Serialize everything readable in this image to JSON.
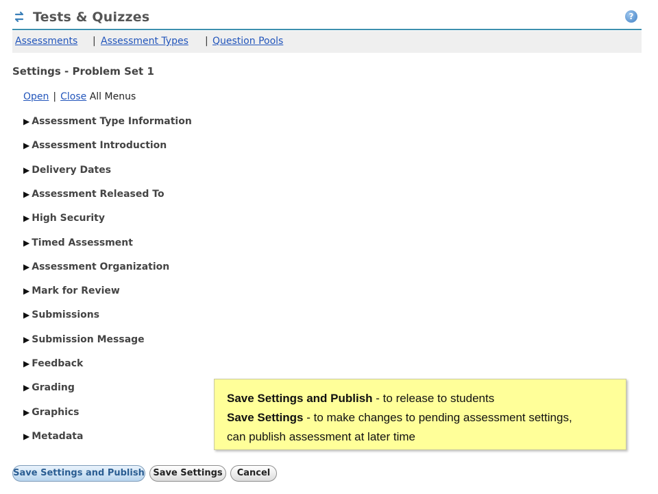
{
  "header": {
    "title": "Tests & Quizzes",
    "tool_icon": "refresh-arrows-icon",
    "help_icon": "help-icon",
    "help_glyph": "?"
  },
  "nav": {
    "items": [
      "Assessments",
      "Assessment Types",
      "Question Pools"
    ],
    "separator": "|"
  },
  "page": {
    "title": "Settings - Problem Set 1"
  },
  "menus": {
    "open": "Open",
    "separator": "|",
    "close": "Close",
    "suffix": "All Menus"
  },
  "sections": [
    "Assessment Type Information",
    "Assessment Introduction",
    "Delivery Dates",
    "Assessment Released To",
    "High Security",
    "Timed Assessment",
    "Assessment Organization",
    "Mark for Review",
    "Submissions",
    "Submission Message",
    "Feedback",
    "Grading",
    "Graphics",
    "Metadata"
  ],
  "callout": {
    "line1_bold": "Save Settings and Publish",
    "line1_rest": " - to release to students",
    "line2_bold": "Save Settings",
    "line2_rest": " - to make changes to pending assessment settings,",
    "line3": "can publish assessment at later time"
  },
  "buttons": {
    "save_publish": "Save Settings and Publish",
    "save": "Save Settings",
    "cancel": "Cancel"
  },
  "colors": {
    "link": "#2255bb",
    "header_rule": "#3c8fae",
    "callout_bg": "#ffff99"
  }
}
